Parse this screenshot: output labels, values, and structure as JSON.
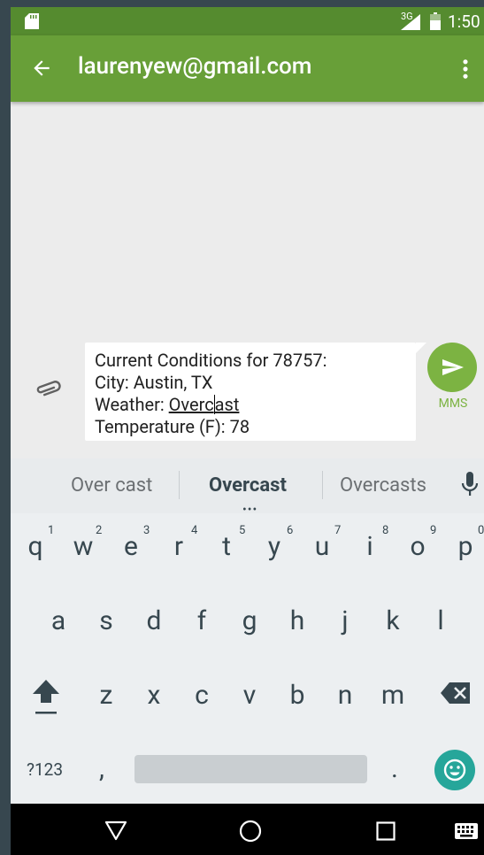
{
  "status_bar": {
    "network": "3G",
    "time": "1:50"
  },
  "app_bar": {
    "title": "laurenyew@gmail.com"
  },
  "compose": {
    "lines": [
      "Current Conditions for 78757:",
      "City: Austin, TX"
    ],
    "weather_prefix": "Weather: ",
    "weather_value_a": "Overc",
    "weather_value_b": "ast",
    "temperature_line": "Temperature (F): 78",
    "send_type_label": "MMS"
  },
  "keyboard": {
    "suggestions": [
      "Over cast",
      "Overcast",
      "Overcasts"
    ],
    "row1": [
      "q",
      "w",
      "e",
      "r",
      "t",
      "y",
      "u",
      "i",
      "o",
      "p"
    ],
    "row1_hints": [
      "1",
      "2",
      "3",
      "4",
      "5",
      "6",
      "7",
      "8",
      "9",
      "0"
    ],
    "row2": [
      "a",
      "s",
      "d",
      "f",
      "g",
      "h",
      "j",
      "k",
      "l"
    ],
    "row3": [
      "z",
      "x",
      "c",
      "v",
      "b",
      "n",
      "m"
    ],
    "symbols_label": "?123",
    "comma": ",",
    "period": "."
  },
  "colors": {
    "status_bar": "#558b2f",
    "app_bar": "#689f38",
    "send_button": "#7cb342",
    "emoji_key": "#26a69a"
  },
  "icons": {
    "status": [
      "sd-card-icon",
      "signal-icon",
      "battery-icon"
    ],
    "app_bar": [
      "back-arrow-icon",
      "more-vert-icon"
    ],
    "compose": [
      "attach-icon",
      "send-icon"
    ],
    "keyboard": [
      "mic-icon",
      "shift-icon",
      "backspace-icon",
      "emoji-icon"
    ],
    "nav": [
      "nav-back-icon",
      "nav-home-icon",
      "nav-recents-icon",
      "keyboard-switch-icon"
    ]
  }
}
